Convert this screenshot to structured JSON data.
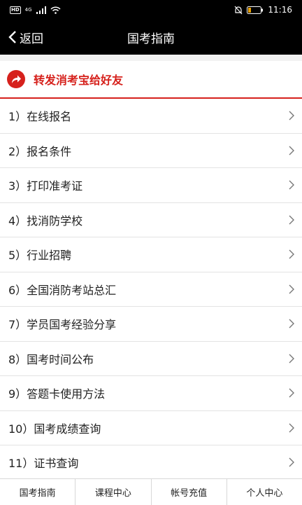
{
  "status_bar": {
    "network_badge": "HD",
    "signal_badge": "4G",
    "time": "11:16"
  },
  "nav": {
    "back_label": "返回",
    "title": "国考指南"
  },
  "share": {
    "label": "转发消考宝给好友",
    "accent_color": "#d6211c"
  },
  "menu": {
    "items": [
      {
        "label": "1）在线报名"
      },
      {
        "label": "2）报名条件"
      },
      {
        "label": "3）打印准考证"
      },
      {
        "label": "4）找消防学校"
      },
      {
        "label": "5）行业招聘"
      },
      {
        "label": "6）全国消防考站总汇"
      },
      {
        "label": "7）学员国考经验分享"
      },
      {
        "label": "8）国考时间公布"
      },
      {
        "label": "9）答题卡使用方法"
      },
      {
        "label": "10）国考成绩查询"
      },
      {
        "label": "11）证书查询"
      }
    ]
  },
  "tabs": [
    {
      "label": "国考指南"
    },
    {
      "label": "课程中心"
    },
    {
      "label": "帐号充值"
    },
    {
      "label": "个人中心"
    }
  ],
  "icons": {
    "back": "chevron-left-icon",
    "share": "share-arrow-icon",
    "row": "chevron-right-icon"
  }
}
